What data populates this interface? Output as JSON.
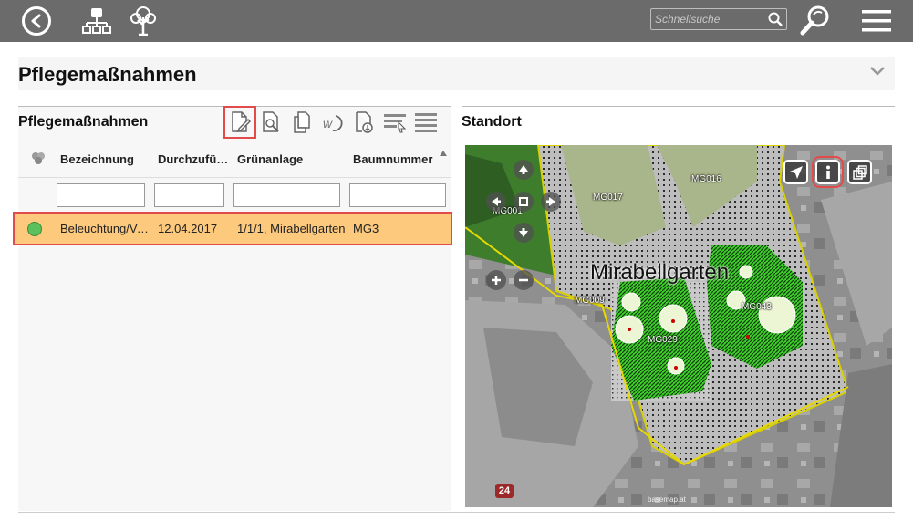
{
  "topbar": {
    "search_placeholder": "Schnellsuche",
    "icons": [
      "back-icon",
      "sitemap-icon",
      "tree-icon",
      "search-icon",
      "zoom-search-icon",
      "menu-icon"
    ]
  },
  "page": {
    "title": "Pflegemaßnahmen"
  },
  "left_panel": {
    "title": "Pflegemaßnahmen",
    "toolbar_icons": [
      "new-document-icon",
      "document-search-icon",
      "copy-document-icon",
      "workorder-icon",
      "document-download-icon",
      "filter-select-icon",
      "filter-clear-icon"
    ],
    "columns": [
      "Bezeichnung",
      "Durchzufüh…",
      "Grünanlage",
      "Baumnummer"
    ],
    "rows": [
      {
        "status_color": "#5cc05c",
        "bezeichnung": "Beleuchtung/Ve…",
        "datum": "12.04.2017",
        "gruenanlage": "1/1/1, Mirabellgarten",
        "baumnummer": "MG3"
      }
    ]
  },
  "right_panel": {
    "title": "Standort",
    "map": {
      "labels": [
        "MG017",
        "MG016",
        "MG001",
        "MG009",
        "MG043",
        "MG029"
      ],
      "park_name": "Mirabellgarten",
      "marker_number": "24",
      "attribution": "basemap.at",
      "buttons": [
        "navigate-icon",
        "info-icon",
        "layers-icon"
      ]
    }
  },
  "colors": {
    "topbar": "#6b6b6b",
    "selected_row": "#fcc97d",
    "highlight": "#e24b4b",
    "status_ok": "#5cc05c"
  }
}
